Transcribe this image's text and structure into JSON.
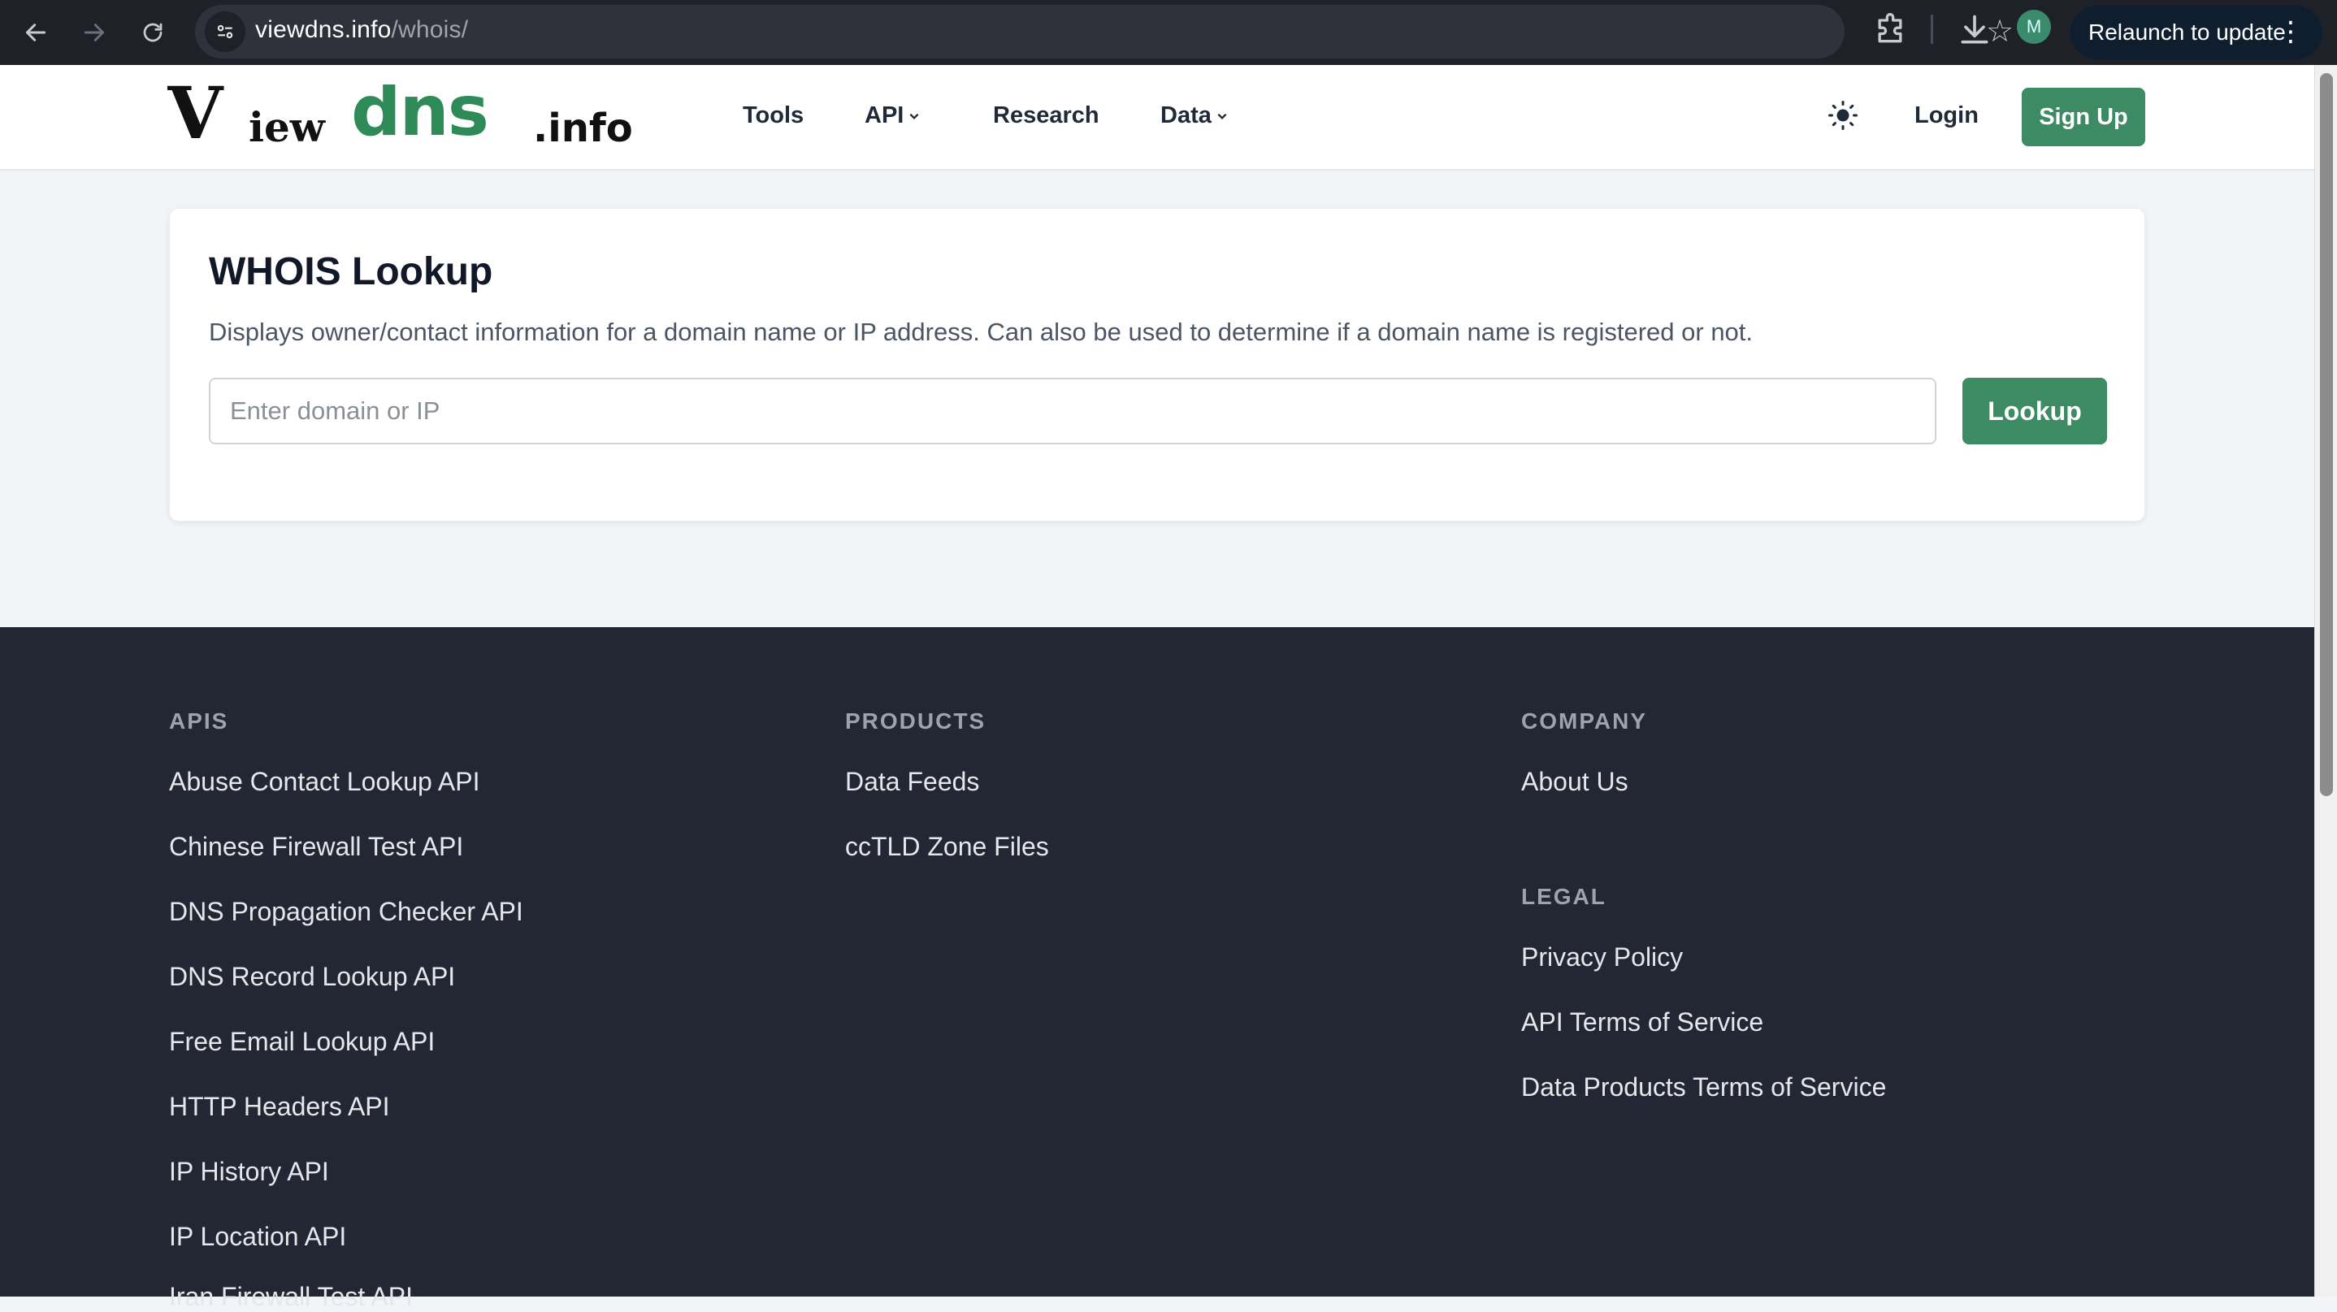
{
  "browser": {
    "url_host": "viewdns.info",
    "url_path": "/whois/",
    "relaunch_label": "Relaunch to update",
    "avatar_initial": "M"
  },
  "header": {
    "logo_text": "ViewDNS.info",
    "nav": [
      {
        "label": "Tools"
      },
      {
        "label": "API"
      },
      {
        "label": "Research"
      },
      {
        "label": "Data"
      }
    ],
    "login_label": "Login",
    "signup_label": "Sign Up",
    "accent_color": "#3d8b63"
  },
  "main": {
    "title": "WHOIS Lookup",
    "description": "Displays owner/contact information for a domain name or IP address. Can also be used to determine if a domain name is registered or not.",
    "input_placeholder": "Enter domain or IP",
    "input_value": "",
    "button_label": "Lookup"
  },
  "footer": {
    "apis": {
      "heading": "APIS",
      "links": [
        "Abuse Contact Lookup API",
        "Chinese Firewall Test API",
        "DNS Propagation Checker API",
        "DNS Record Lookup API",
        "Free Email Lookup API",
        "HTTP Headers API",
        "IP History API",
        "IP Location API",
        "Iran Firewall Test API"
      ]
    },
    "products": {
      "heading": "PRODUCTS",
      "links": [
        "Data Feeds",
        "ccTLD Zone Files"
      ]
    },
    "company": {
      "heading": "COMPANY",
      "links": [
        "About Us"
      ]
    },
    "legal": {
      "heading": "LEGAL",
      "links": [
        "Privacy Policy",
        "API Terms of Service",
        "Data Products Terms of Service"
      ]
    }
  }
}
